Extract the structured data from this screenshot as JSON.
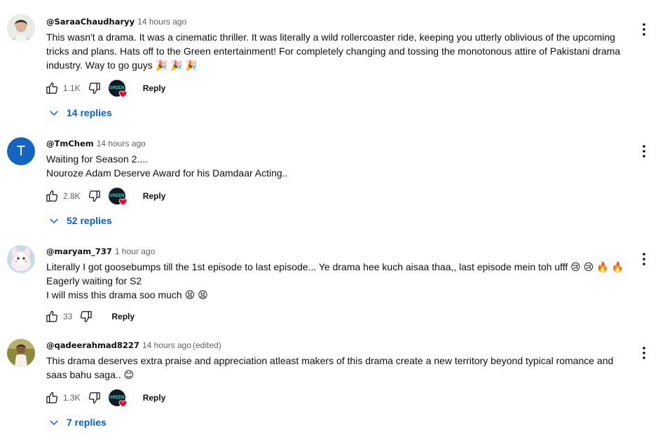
{
  "comments": [
    {
      "author": "@SaraaChaudharyy",
      "time": "14 hours ago",
      "edited": "",
      "lines": [
        "This wasn't a drama. It was a cinematic thriller. It was literally a wild rollercoaster ride, keeping you utterly oblivious of the upcoming",
        "tricks and plans. Hats off to the Green entertainment! For completely changing and tossing the monotonous attire of Pakistani drama",
        "industry. Way to go guys 🎉 🎉 🎉"
      ],
      "likes": "1.1K",
      "reply_label": "Reply",
      "replies_label": "14 replies",
      "creator_heart": true
    },
    {
      "author": "@TmChem",
      "time": "14 hours ago",
      "edited": "",
      "avatar_letter": "T",
      "lines": [
        "Waiting for Season 2....",
        "Nouroze Adam Deserve Award for his Damdaar Acting.."
      ],
      "likes": "2.8K",
      "reply_label": "Reply",
      "replies_label": "52 replies",
      "creator_heart": true
    },
    {
      "author": "@maryam_737",
      "time": "1 hour ago",
      "edited": "",
      "lines": [
        "Literally I got goosebumps till the 1st episode to last episode... Ye drama hee kuch aisaa thaa,, last episode mein toh ufff 😢 😢 🔥 🔥",
        "Eagerly waiting for S2",
        "I will miss this drama soo much 😫 😫"
      ],
      "likes": "33",
      "reply_label": "Reply",
      "creator_heart": false
    },
    {
      "author": "@qadeerahmad8227",
      "time": "14 hours ago",
      "edited": "(edited)",
      "lines": [
        "This drama deserves extra praise and appreciation atleast makers of this drama create a new territory beyond typical romance and",
        "saas bahu saga.. 😊"
      ],
      "likes": "1.3K",
      "reply_label": "Reply",
      "replies_label": "7 replies",
      "creator_heart": true
    }
  ],
  "creator_avatar_text": "GREEN",
  "icons": {
    "like": "thumbs-up-icon",
    "dislike": "thumbs-down-icon",
    "menu": "more-vert-icon",
    "expand": "chevron-down-icon",
    "heart": "heart-icon"
  },
  "colors": {
    "link_blue": "#065fd4",
    "heart_red": "#ff0033",
    "muted": "#606060"
  }
}
